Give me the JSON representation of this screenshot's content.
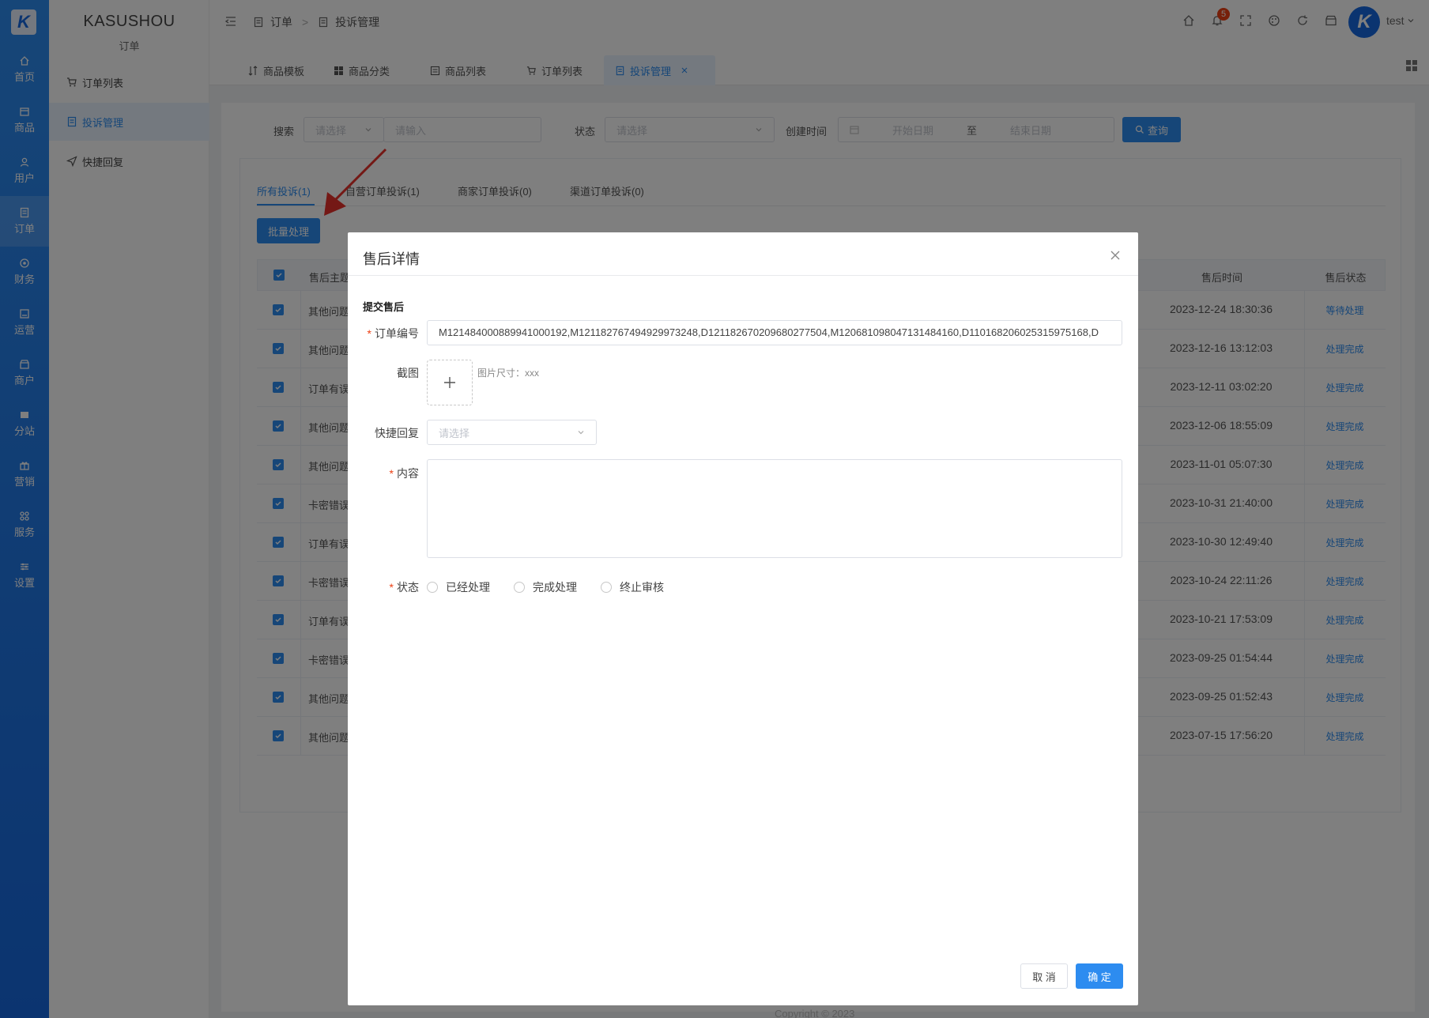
{
  "app": {
    "brand": "KASUSHOU",
    "section": "订单",
    "logo_text": "K"
  },
  "rail": [
    {
      "label": "首页",
      "icon": "home-icon"
    },
    {
      "label": "商品",
      "icon": "goods-icon"
    },
    {
      "label": "用户",
      "icon": "user-icon"
    },
    {
      "label": "订单",
      "icon": "order-icon"
    },
    {
      "label": "财务",
      "icon": "finance-icon"
    },
    {
      "label": "运营",
      "icon": "operation-icon"
    },
    {
      "label": "商户",
      "icon": "merchant-icon"
    },
    {
      "label": "分站",
      "icon": "substation-icon"
    },
    {
      "label": "营销",
      "icon": "marketing-icon"
    },
    {
      "label": "服务",
      "icon": "service-icon"
    },
    {
      "label": "设置",
      "icon": "settings-icon"
    }
  ],
  "subnav": [
    {
      "label": "订单列表"
    },
    {
      "label": "投诉管理"
    },
    {
      "label": "快捷回复"
    }
  ],
  "header": {
    "breadcrumb": [
      "订单",
      "投诉管理"
    ],
    "breadcrumb_sep": ">",
    "notification_count": "5",
    "username": "test"
  },
  "tabs": [
    {
      "label": "商品模板"
    },
    {
      "label": "商品分类"
    },
    {
      "label": "商品列表"
    },
    {
      "label": "订单列表"
    },
    {
      "label": "投诉管理"
    }
  ],
  "search": {
    "search_label": "搜索",
    "select_placeholder": "请选择",
    "input_placeholder": "请输入",
    "status_label": "状态",
    "status_placeholder": "请选择",
    "created_label": "创建时间",
    "start_placeholder": "开始日期",
    "range_sep": "至",
    "end_placeholder": "结束日期",
    "query_button": "查询"
  },
  "content_tabs": [
    {
      "label": "所有投诉(1)"
    },
    {
      "label": "自营订单投诉(1)"
    },
    {
      "label": "商家订单投诉(0)"
    },
    {
      "label": "渠道订单投诉(0)"
    }
  ],
  "batch_button": "批量处理",
  "table": {
    "headers": {
      "subject": "售后主题",
      "time": "售后时间",
      "status": "售后状态"
    },
    "rows": [
      {
        "subject": "其他问题",
        "time": "2023-12-24 18:30:36",
        "status": "等待处理"
      },
      {
        "subject": "其他问题",
        "time": "2023-12-16 13:12:03",
        "status": "处理完成"
      },
      {
        "subject": "订单有误",
        "time": "2023-12-11 03:02:20",
        "status": "处理完成"
      },
      {
        "subject": "其他问题",
        "time": "2023-12-06 18:55:09",
        "status": "处理完成"
      },
      {
        "subject": "其他问题",
        "time": "2023-11-01 05:07:30",
        "status": "处理完成"
      },
      {
        "subject": "卡密错误",
        "time": "2023-10-31 21:40:00",
        "status": "处理完成"
      },
      {
        "subject": "订单有误",
        "time": "2023-10-30 12:49:40",
        "status": "处理完成"
      },
      {
        "subject": "卡密错误",
        "time": "2023-10-24 22:11:26",
        "status": "处理完成"
      },
      {
        "subject": "订单有误",
        "time": "2023-10-21 17:53:09",
        "status": "处理完成"
      },
      {
        "subject": "卡密错误",
        "time": "2023-09-25 01:54:44",
        "status": "处理完成"
      },
      {
        "subject": "其他问题",
        "time": "2023-09-25 01:52:43",
        "status": "处理完成"
      },
      {
        "subject": "其他问题",
        "time": "2023-07-15 17:56:20",
        "status": "处理完成"
      }
    ]
  },
  "modal": {
    "title": "售后详情",
    "section": "提交售后",
    "order_label": "订单编号",
    "order_value": "M121484000889941000192,M121182767494929973248,D121182670209680277504,M120681098047131484160,D110168206025315975168,D",
    "screenshot_label": "截图",
    "screenshot_hint": "图片尺寸：xxx",
    "quick_reply_label": "快捷回复",
    "quick_reply_placeholder": "请选择",
    "content_label": "内容",
    "content_value": "",
    "status_label": "状态",
    "status_options": [
      "已经处理",
      "完成处理",
      "终止审核"
    ],
    "cancel_button": "取 消",
    "confirm_button": "确 定"
  },
  "footer": "Copyright © 2023",
  "colors": {
    "primary": "#2d8cf0",
    "danger": "#ed4014",
    "rail": "#1769e0"
  }
}
